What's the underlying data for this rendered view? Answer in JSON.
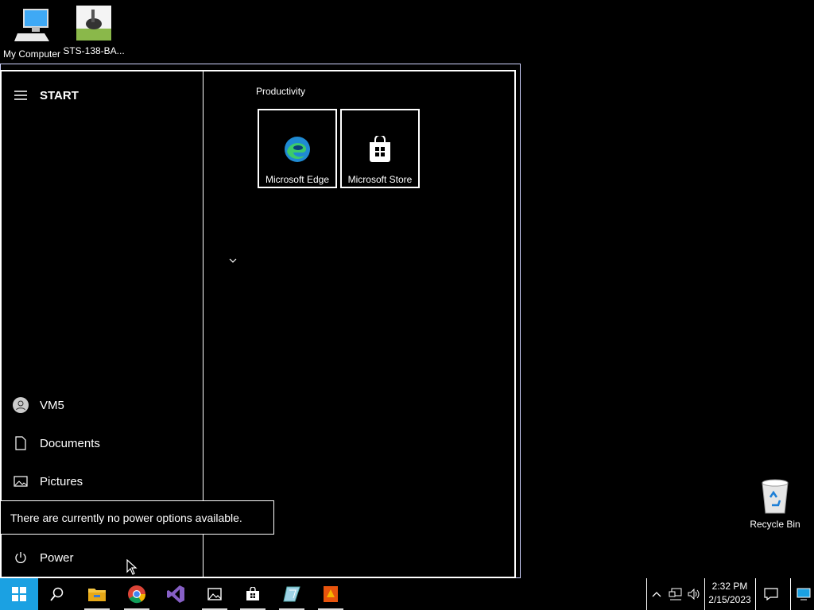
{
  "desktop": {
    "icons": [
      {
        "label": "My Computer",
        "icon": "computer-icon"
      },
      {
        "label": "STS-138-BA...",
        "icon": "image-file-icon"
      },
      {
        "label": "Recycle Bin",
        "icon": "recycle-bin-icon"
      }
    ]
  },
  "start_menu": {
    "title": "START",
    "items": [
      {
        "label": "VM5",
        "icon": "user-icon"
      },
      {
        "label": "Documents",
        "icon": "document-icon"
      },
      {
        "label": "Pictures",
        "icon": "pictures-icon"
      },
      {
        "label": "Power",
        "icon": "power-icon"
      }
    ],
    "tooltip": "There are currently no power options available.",
    "group_title": "Productivity",
    "tiles": [
      {
        "label": "Microsoft Edge",
        "icon": "edge-icon"
      },
      {
        "label": "Microsoft Store",
        "icon": "store-icon"
      }
    ]
  },
  "taskbar": {
    "apps": [
      "file-explorer-icon",
      "chrome-icon",
      "visual-studio-icon",
      "photos-icon",
      "store-icon",
      "app-icon",
      "app-icon"
    ],
    "clock": {
      "time": "2:32 PM",
      "date": "2/15/2023"
    }
  },
  "colors": {
    "accent": "#1ba1e2",
    "background": "#000000"
  }
}
